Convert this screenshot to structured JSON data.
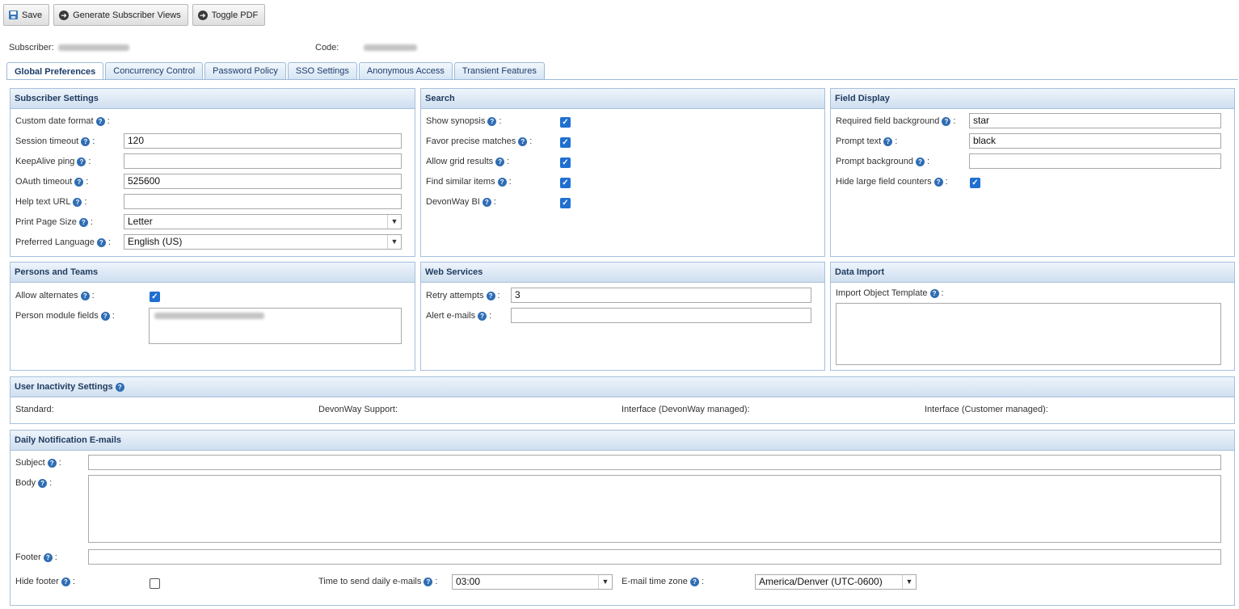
{
  "toolbar": {
    "save": "Save",
    "generate": "Generate Subscriber Views",
    "toggle_pdf": "Toggle PDF"
  },
  "subscriber": {
    "label": "Subscriber:",
    "code_label": "Code:"
  },
  "tabs": [
    {
      "label": "Global Preferences",
      "active": true
    },
    {
      "label": "Concurrency Control"
    },
    {
      "label": "Password Policy"
    },
    {
      "label": "SSO Settings"
    },
    {
      "label": "Anonymous Access"
    },
    {
      "label": "Transient Features"
    }
  ],
  "subscriber_settings": {
    "title": "Subscriber Settings",
    "custom_date_format": "Custom date format",
    "session_timeout": "Session timeout",
    "session_timeout_value": "120",
    "keepalive_ping": "KeepAlive ping",
    "keepalive_value": "",
    "oauth_timeout": "OAuth timeout",
    "oauth_timeout_value": "525600",
    "help_text_url": "Help text URL",
    "help_text_url_value": "",
    "print_page_size": "Print Page Size",
    "print_page_size_value": "Letter",
    "preferred_language": "Preferred Language",
    "preferred_language_value": "English (US)"
  },
  "search": {
    "title": "Search",
    "show_synopsis": "Show synopsis",
    "favor_precise": "Favor precise matches",
    "allow_grid": "Allow grid results",
    "find_similar": "Find similar items",
    "devonway_bi": "DevonWay BI",
    "checked": [
      true,
      true,
      true,
      true,
      true
    ]
  },
  "field_display": {
    "title": "Field Display",
    "required_bg": "Required field background",
    "required_bg_value": "star",
    "prompt_text": "Prompt text",
    "prompt_text_value": "black",
    "prompt_bg": "Prompt background",
    "prompt_bg_value": "",
    "hide_counters": "Hide large field counters",
    "hide_counters_checked": true
  },
  "persons_teams": {
    "title": "Persons and Teams",
    "allow_alternates": "Allow alternates",
    "allow_alternates_checked": true,
    "person_module_fields": "Person module fields"
  },
  "web_services": {
    "title": "Web Services",
    "retry_attempts": "Retry attempts",
    "retry_attempts_value": "3",
    "alert_emails": "Alert e-mails",
    "alert_emails_value": ""
  },
  "data_import": {
    "title": "Data Import",
    "import_template": "Import Object Template"
  },
  "user_inactivity": {
    "title": "User Inactivity Settings",
    "standard": "Standard:",
    "devonway_support": "DevonWay Support:",
    "interface_devonway": "Interface (DevonWay managed):",
    "interface_customer": "Interface (Customer managed):"
  },
  "daily_notification": {
    "title": "Daily Notification E-mails",
    "subject": "Subject",
    "body": "Body",
    "footer": "Footer",
    "hide_footer": "Hide footer",
    "hide_footer_checked": false,
    "time_to_send": "Time to send daily e-mails",
    "time_value": "03:00",
    "email_time_zone": "E-mail time zone",
    "time_zone_value": "America/Denver (UTC-0600)"
  },
  "icons": {
    "save": "save-icon",
    "arrow": "arrow-right-circle-icon",
    "help": "help-icon",
    "check": "checkmark-icon",
    "dropdown": "chevron-down-icon"
  },
  "colors": {
    "accent": "#1f6fd1",
    "panel_border": "#a6c0dc",
    "panel_header": "#cfdff0",
    "tab_text": "#1c3d6b"
  }
}
